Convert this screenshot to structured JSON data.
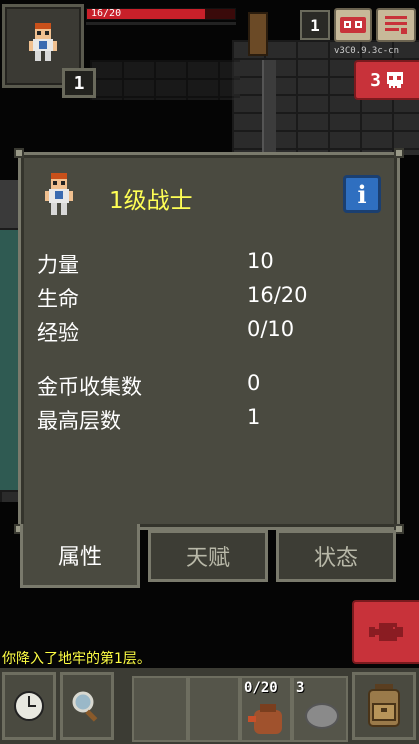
{
  "hud": {
    "hp_text": "16/20",
    "hp_fraction": 0.8,
    "hero_level": "1",
    "depth": "1",
    "version": "v3C0.9.3c-cn",
    "danger_count": "3",
    "journal_icon": "journal-icon",
    "menu_icon": "menu-icon",
    "skull_icon": "skull-icon"
  },
  "window": {
    "title": "1级战士",
    "info_icon_glyph": "i",
    "stats": [
      {
        "label": "力量",
        "value": "10"
      },
      {
        "label": "生命",
        "value": "16/20"
      },
      {
        "label": "经验",
        "value": "0/10"
      }
    ],
    "stats2": [
      {
        "label": "金币收集数",
        "value": "0"
      },
      {
        "label": "最高层数",
        "value": "1"
      }
    ],
    "tabs": [
      {
        "label": "属性",
        "active": true
      },
      {
        "label": "天赋",
        "active": false
      },
      {
        "label": "状态",
        "active": false
      }
    ]
  },
  "log": {
    "message": "你降入了地牢的第1层。"
  },
  "toolbar": {
    "wait_icon": "clock-icon",
    "search_icon": "magnifier-icon",
    "slot_waterskin_text": "0/20",
    "slot_stone_count": "3",
    "backpack_icon": "backpack-icon",
    "catalog_icon": "fish-icon"
  },
  "colors": {
    "window_bg": "#4a4a40",
    "title_yellow": "#ffff55",
    "log_yellow": "#ffff44",
    "danger_red": "#c8323a",
    "hp_red": "#c8202a",
    "info_blue": "#2f6fc0"
  }
}
